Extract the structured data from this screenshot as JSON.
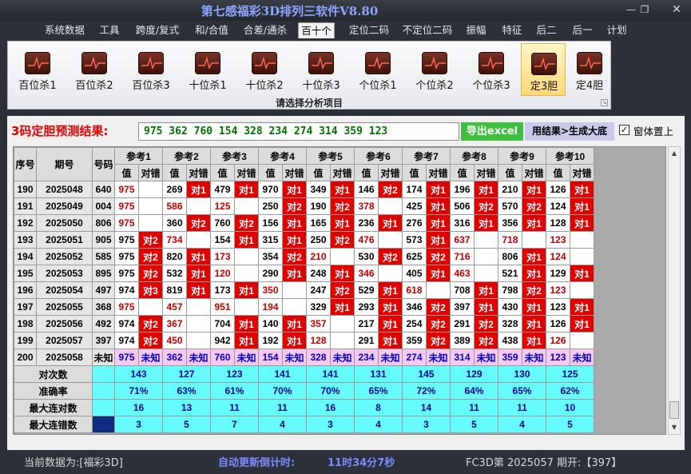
{
  "window": {
    "title": "第七感福彩3D排列三软件V8.80",
    "min_icon": "minimize-icon",
    "max_icon": "maximize-icon",
    "close_icon": "close-icon"
  },
  "menu": [
    "系统数据",
    "工具",
    "跨度/复式",
    "和/合值",
    "合差/通杀",
    "百十个",
    "定位二码",
    "不定位二码",
    "振幅",
    "特征",
    "后二",
    "后一",
    "计划"
  ],
  "active_menu": "百十个",
  "ribbon": {
    "buttons": [
      "百位杀1",
      "百位杀2",
      "百位杀3",
      "十位杀1",
      "十位杀2",
      "十位杀3",
      "个位杀1",
      "个位杀2",
      "个位杀3",
      "定3胆",
      "定4胆"
    ],
    "selected": "定3胆",
    "caption": "请选择分析项目",
    "button_icon": "line-chart-icon"
  },
  "prediction": {
    "label": "3码定胆预测结果:",
    "value": "975 362 760 154 328 234 274 314 359 123",
    "export_button": "导出excel",
    "generate_button": "用结果>生成大底",
    "checkbox_label": "窗体置上",
    "checkbox_checked": true
  },
  "table": {
    "headers": {
      "seq": "序号",
      "period": "期号",
      "number": "号码",
      "value": "值",
      "judge": "对错"
    },
    "refs": [
      "参考1",
      "参考2",
      "参考3",
      "参考4",
      "参考5",
      "参考6",
      "参考7",
      "参考8",
      "参考9",
      "参考10"
    ],
    "rows": [
      {
        "seq": "190",
        "period": "2025048",
        "number": "640",
        "cells": [
          [
            "975",
            "",
            1
          ],
          [
            "269",
            "对1",
            0
          ],
          [
            "479",
            "对1",
            0
          ],
          [
            "970",
            "对1",
            0
          ],
          [
            "349",
            "对1",
            0
          ],
          [
            "146",
            "对2",
            0
          ],
          [
            "174",
            "对1",
            0
          ],
          [
            "196",
            "对1",
            0
          ],
          [
            "210",
            "对1",
            0
          ],
          [
            "126",
            "对1",
            0
          ]
        ]
      },
      {
        "seq": "191",
        "period": "2025049",
        "number": "004",
        "cells": [
          [
            "975",
            "",
            1
          ],
          [
            "586",
            "",
            1
          ],
          [
            "125",
            "",
            1
          ],
          [
            "250",
            "对2",
            0
          ],
          [
            "190",
            "对2",
            0
          ],
          [
            "378",
            "",
            1
          ],
          [
            "425",
            "对1",
            0
          ],
          [
            "506",
            "对2",
            0
          ],
          [
            "570",
            "对2",
            0
          ],
          [
            "124",
            "对1",
            0
          ]
        ]
      },
      {
        "seq": "192",
        "period": "2025050",
        "number": "806",
        "cells": [
          [
            "975",
            "",
            1
          ],
          [
            "360",
            "对2",
            0
          ],
          [
            "760",
            "对2",
            0
          ],
          [
            "156",
            "对1",
            0
          ],
          [
            "165",
            "对1",
            0
          ],
          [
            "236",
            "对1",
            0
          ],
          [
            "276",
            "对1",
            0
          ],
          [
            "316",
            "对1",
            0
          ],
          [
            "356",
            "对1",
            0
          ],
          [
            "128",
            "对1",
            0
          ]
        ]
      },
      {
        "seq": "193",
        "period": "2025051",
        "number": "905",
        "cells": [
          [
            "975",
            "对2",
            0
          ],
          [
            "734",
            "",
            1
          ],
          [
            "154",
            "对1",
            0
          ],
          [
            "315",
            "对1",
            0
          ],
          [
            "250",
            "对2",
            0
          ],
          [
            "476",
            "",
            1
          ],
          [
            "573",
            "对1",
            0
          ],
          [
            "637",
            "",
            1
          ],
          [
            "718",
            "",
            1
          ],
          [
            "123",
            "",
            1
          ]
        ]
      },
      {
        "seq": "194",
        "period": "2025052",
        "number": "585",
        "cells": [
          [
            "975",
            "对2",
            0
          ],
          [
            "820",
            "对1",
            0
          ],
          [
            "173",
            "",
            1
          ],
          [
            "354",
            "对2",
            0
          ],
          [
            "210",
            "",
            1
          ],
          [
            "530",
            "对2",
            0
          ],
          [
            "625",
            "对2",
            0
          ],
          [
            "716",
            "",
            1
          ],
          [
            "806",
            "对1",
            0
          ],
          [
            "124",
            "",
            1
          ]
        ]
      },
      {
        "seq": "195",
        "period": "2025053",
        "number": "895",
        "cells": [
          [
            "975",
            "对2",
            0
          ],
          [
            "532",
            "对1",
            0
          ],
          [
            "120",
            "",
            1
          ],
          [
            "290",
            "对1",
            0
          ],
          [
            "248",
            "对1",
            0
          ],
          [
            "346",
            "",
            1
          ],
          [
            "405",
            "对1",
            0
          ],
          [
            "463",
            "",
            1
          ],
          [
            "521",
            "对1",
            0
          ],
          [
            "129",
            "对1",
            0
          ]
        ]
      },
      {
        "seq": "196",
        "period": "2025054",
        "number": "497",
        "cells": [
          [
            "974",
            "对3",
            0
          ],
          [
            "819",
            "对1",
            0
          ],
          [
            "173",
            "对1",
            0
          ],
          [
            "350",
            "",
            1
          ],
          [
            "247",
            "对2",
            0
          ],
          [
            "529",
            "对1",
            0
          ],
          [
            "618",
            "",
            1
          ],
          [
            "708",
            "对1",
            0
          ],
          [
            "798",
            "对2",
            0
          ],
          [
            "123",
            "",
            1
          ]
        ]
      },
      {
        "seq": "197",
        "period": "2025055",
        "number": "368",
        "cells": [
          [
            "975",
            "",
            1
          ],
          [
            "457",
            "",
            1
          ],
          [
            "951",
            "",
            1
          ],
          [
            "194",
            "",
            1
          ],
          [
            "329",
            "对1",
            0
          ],
          [
            "293",
            "对1",
            0
          ],
          [
            "346",
            "对2",
            0
          ],
          [
            "397",
            "对1",
            0
          ],
          [
            "430",
            "对1",
            0
          ],
          [
            "123",
            "对1",
            0
          ]
        ]
      },
      {
        "seq": "198",
        "period": "2025056",
        "number": "492",
        "cells": [
          [
            "974",
            "对2",
            0
          ],
          [
            "367",
            "",
            1
          ],
          [
            "704",
            "对1",
            0
          ],
          [
            "140",
            "对1",
            0
          ],
          [
            "357",
            "",
            1
          ],
          [
            "217",
            "对1",
            0
          ],
          [
            "254",
            "对2",
            0
          ],
          [
            "291",
            "对2",
            0
          ],
          [
            "328",
            "对1",
            0
          ],
          [
            "126",
            "对1",
            0
          ]
        ]
      },
      {
        "seq": "199",
        "period": "2025057",
        "number": "397",
        "cells": [
          [
            "974",
            "对2",
            0
          ],
          [
            "450",
            "",
            1
          ],
          [
            "942",
            "对1",
            0
          ],
          [
            "192",
            "对1",
            0
          ],
          [
            "128",
            "",
            1
          ],
          [
            "291",
            "对1",
            0
          ],
          [
            "359",
            "对2",
            0
          ],
          [
            "389",
            "对2",
            0
          ],
          [
            "438",
            "对1",
            0
          ],
          [
            "126",
            "",
            1
          ]
        ]
      }
    ],
    "pred_row": {
      "seq": "200",
      "period": "2025058",
      "number": "未知",
      "values": [
        "975",
        "362",
        "760",
        "154",
        "328",
        "234",
        "274",
        "314",
        "359",
        "123"
      ],
      "unknown": "未知"
    },
    "stats": [
      {
        "label": "对次数",
        "values": [
          "143",
          "127",
          "123",
          "141",
          "141",
          "131",
          "145",
          "129",
          "130",
          "125"
        ]
      },
      {
        "label": "准确率",
        "values": [
          "71%",
          "63%",
          "61%",
          "70%",
          "70%",
          "65%",
          "72%",
          "64%",
          "65%",
          "62%"
        ]
      },
      {
        "label": "最大连对数",
        "values": [
          "16",
          "13",
          "11",
          "11",
          "16",
          "8",
          "14",
          "11",
          "11",
          "10"
        ]
      },
      {
        "label": "最大连错数",
        "values": [
          "3",
          "5",
          "7",
          "4",
          "3",
          "4",
          "3",
          "5",
          "4",
          "5"
        ]
      }
    ]
  },
  "status": {
    "current_data": "当前数据为:[福彩3D]",
    "countdown_label": "自动更新倒计时:",
    "countdown_value": "11时34分7秒",
    "issue": "FC3D第 2025057 期开:【397】"
  },
  "colors": {
    "hit": "#e00000",
    "miss_value": "#c00000",
    "pred_row": "#f7c8f0",
    "stats": "#66fcfc",
    "title": "#8aa6ff",
    "countdown": "#7c8cff"
  }
}
